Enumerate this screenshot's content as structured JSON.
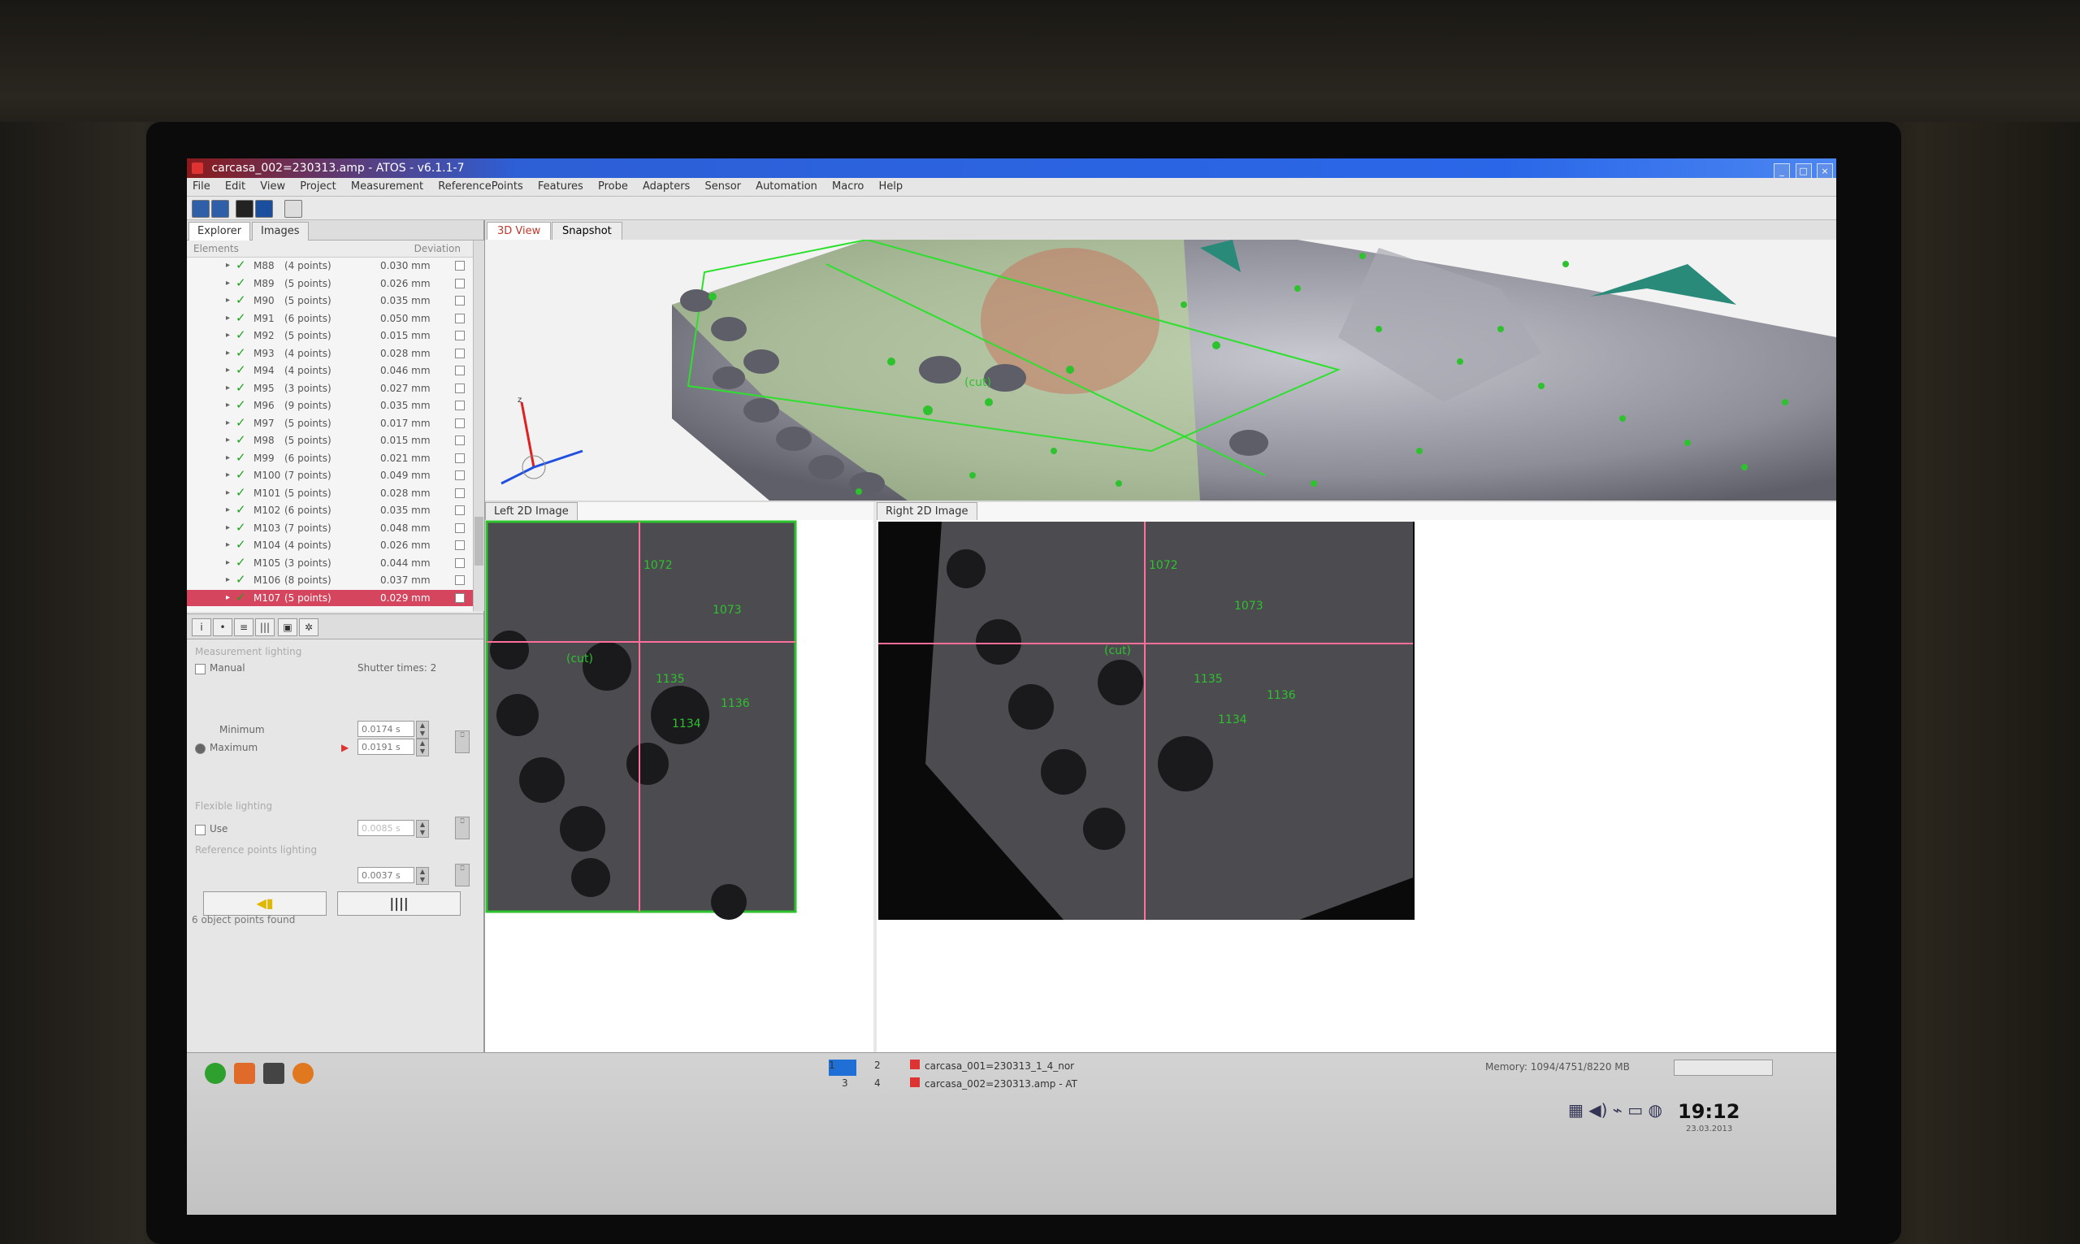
{
  "window": {
    "title": "carcasa_002=230313.amp - ATOS - v6.1.1-7",
    "controls": [
      "_",
      "□",
      "×"
    ]
  },
  "menu": [
    "File",
    "Edit",
    "View",
    "Project",
    "Measurement",
    "ReferencePoints",
    "Features",
    "Probe",
    "Adapters",
    "Sensor",
    "Automation",
    "Macro",
    "Help"
  ],
  "left_panel": {
    "tabs": [
      "Explorer",
      "Images"
    ],
    "header": {
      "name_col": "Elements",
      "value_col": "Deviation"
    },
    "items": [
      {
        "name": "M88",
        "points": "(4 points)",
        "deviation": "0.030 mm"
      },
      {
        "name": "M89",
        "points": "(5 points)",
        "deviation": "0.026 mm"
      },
      {
        "name": "M90",
        "points": "(5 points)",
        "deviation": "0.035 mm"
      },
      {
        "name": "M91",
        "points": "(6 points)",
        "deviation": "0.050 mm"
      },
      {
        "name": "M92",
        "points": "(5 points)",
        "deviation": "0.015 mm"
      },
      {
        "name": "M93",
        "points": "(4 points)",
        "deviation": "0.028 mm"
      },
      {
        "name": "M94",
        "points": "(4 points)",
        "deviation": "0.046 mm"
      },
      {
        "name": "M95",
        "points": "(3 points)",
        "deviation": "0.027 mm"
      },
      {
        "name": "M96",
        "points": "(9 points)",
        "deviation": "0.035 mm"
      },
      {
        "name": "M97",
        "points": "(5 points)",
        "deviation": "0.017 mm"
      },
      {
        "name": "M98",
        "points": "(5 points)",
        "deviation": "0.015 mm"
      },
      {
        "name": "M99",
        "points": "(6 points)",
        "deviation": "0.021 mm"
      },
      {
        "name": "M100",
        "points": "(7 points)",
        "deviation": "0.049 mm"
      },
      {
        "name": "M101",
        "points": "(5 points)",
        "deviation": "0.028 mm"
      },
      {
        "name": "M102",
        "points": "(6 points)",
        "deviation": "0.035 mm"
      },
      {
        "name": "M103",
        "points": "(7 points)",
        "deviation": "0.048 mm"
      },
      {
        "name": "M104",
        "points": "(4 points)",
        "deviation": "0.026 mm"
      },
      {
        "name": "M105",
        "points": "(3 points)",
        "deviation": "0.044 mm"
      },
      {
        "name": "M106",
        "points": "(8 points)",
        "deviation": "0.037 mm"
      },
      {
        "name": "M107",
        "points": "(5 points)",
        "deviation": "0.029 mm"
      }
    ],
    "selected_index": 19,
    "props": {
      "section1": "Measurement lighting",
      "manual_label": "Manual",
      "shutter_label": "Shutter times: 2",
      "minimum_label": "Minimum",
      "minimum_value": "0.0174 s",
      "maximum_label": "Maximum",
      "maximum_value": "0.0191 s",
      "section2": "Flexible lighting",
      "use_label": "Use",
      "use_value": "0.0085 s",
      "section3": "Reference points lighting",
      "ref_value": "0.0037 s",
      "status": "6 object points found"
    }
  },
  "view3d": {
    "tabs": [
      "3D View",
      "Snapshot"
    ],
    "labels": [
      "(cut)"
    ]
  },
  "image_panels": {
    "left": {
      "title": "Left 2D Image",
      "labels": [
        "1072",
        "1073",
        "(cut)",
        "1135",
        "1136",
        "1134"
      ]
    },
    "right": {
      "title": "Right 2D Image",
      "labels": [
        "1072",
        "1073",
        "(cut)",
        "1135",
        "1136",
        "1134"
      ]
    }
  },
  "taskbar": {
    "workspaces": [
      "1",
      "2",
      "3",
      "4"
    ],
    "tasks": [
      {
        "label": "carcasa_001=230313_1_4_nor"
      },
      {
        "label": "carcasa_002=230313.amp - AT"
      }
    ],
    "memory": "Memory: 1094/4751/8220 MB",
    "clock": "19:12",
    "date": "23.03.2013"
  },
  "colors": {
    "selection": "#d6455e",
    "check": "#1ea21e",
    "marker": "#2ec22e",
    "crosshair": "#ff6f9a"
  }
}
